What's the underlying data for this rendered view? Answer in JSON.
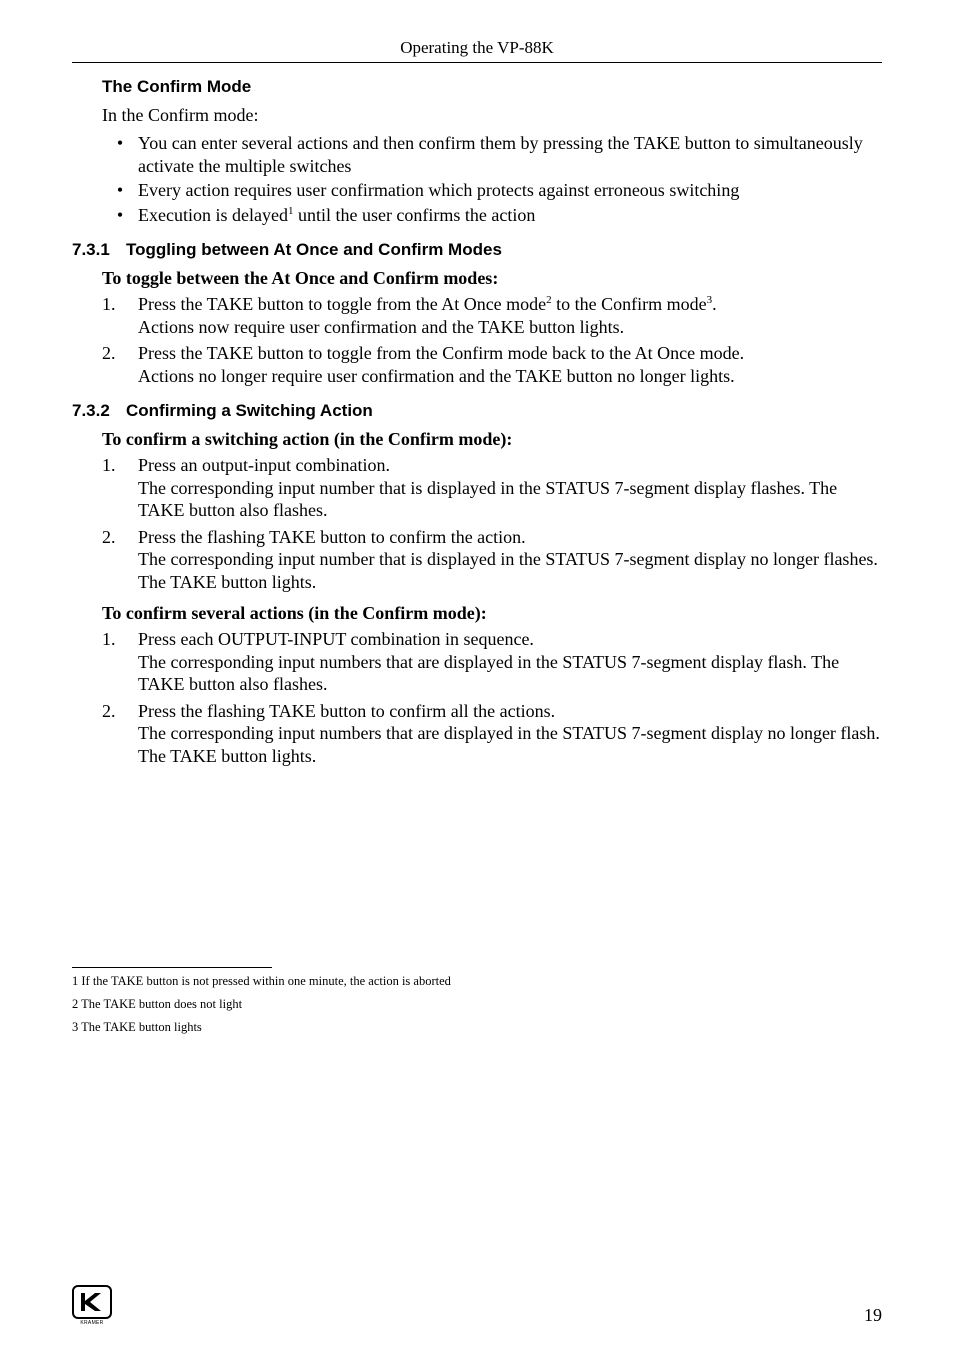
{
  "header": {
    "running": "Operating the VP-88K"
  },
  "s_confirm": {
    "title": "The Confirm Mode",
    "intro": "In the Confirm mode:",
    "b1": "You can enter several actions and then confirm them by pressing the TAKE button to simultaneously activate the multiple switches",
    "b2": "Every action requires user confirmation which protects against erroneous switching",
    "b3a": "Execution is delayed",
    "b3b": " until the user confirms the action",
    "fn1": "1"
  },
  "s731": {
    "num": "7.3.1",
    "title": "Toggling between At Once and Confirm Modes",
    "lead": "To toggle between the At Once and Confirm modes:",
    "i1n": "1.",
    "i1a": "Press the TAKE button to toggle from the At Once mode",
    "i1b": " to the Confirm mode",
    "i1c": ".",
    "i1d": "Actions now require user confirmation and the TAKE button lights.",
    "fn2": "2",
    "fn3": "3",
    "i2n": "2.",
    "i2a": "Press the TAKE button to toggle from the Confirm mode back to the At Once mode.",
    "i2b": "Actions no longer require user confirmation and the TAKE button no longer lights."
  },
  "s732": {
    "num": "7.3.2",
    "title": "Confirming a Switching Action",
    "leadA": "To confirm a switching action (in the Confirm mode):",
    "a1n": "1.",
    "a1": "Press an output-input combination.",
    "a1b": "The corresponding input number that is displayed in the STATUS 7-segment display flashes. The TAKE button also flashes.",
    "a2n": "2.",
    "a2": "Press the flashing TAKE button to confirm the action.",
    "a2b": "The corresponding input number that is displayed in the STATUS 7-segment display no longer flashes. The TAKE button lights.",
    "leadB": "To confirm several actions (in the Confirm mode):",
    "b1n": "1.",
    "b1": "Press each OUTPUT-INPUT combination in sequence.",
    "b1b": "The corresponding input numbers that are displayed in the STATUS 7-segment display flash. The TAKE button also flashes.",
    "b2n": "2.",
    "b2": "Press the flashing TAKE button to confirm all the actions.",
    "b2b": "The corresponding input numbers that are displayed in the STATUS 7-segment display no longer flash. The TAKE button lights."
  },
  "footnotes": {
    "f1": "1 If the TAKE button is not pressed within one minute, the action is aborted",
    "f2": "2 The TAKE button does not light",
    "f3": "3 The TAKE button lights"
  },
  "footer": {
    "logo_caption": "KRAMER",
    "page": "19"
  }
}
